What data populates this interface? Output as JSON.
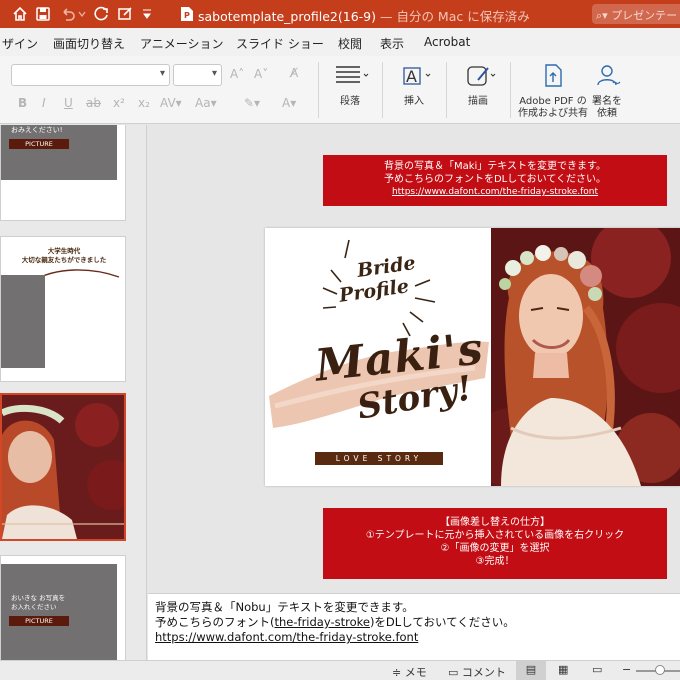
{
  "titlebar": {
    "doc_name": "sabotemplate_profile2(16-9)",
    "save_status": "— 自分の Mac に保存済み",
    "search_placeholder": "プレゼンテー",
    "color": "#c43e1c"
  },
  "ribbon_tabs": [
    "ザイン",
    "画面切り替え",
    "アニメーション",
    "スライド ショー",
    "校閲",
    "表示",
    "Acrobat"
  ],
  "ribbon": {
    "paragraph_label": "段落",
    "insert_label": "挿入",
    "draw_label": "描画",
    "adobe_pdf_label": "Adobe PDF の\n作成および共有",
    "sign_label": "署名を\n依頼"
  },
  "thumbnails": {
    "thumb1_text": "おみえください!",
    "thumb1_badge": "PICTURE",
    "thumb2_title": "大学生時代\n大切な親友たちができました",
    "thumb4_text": "おいきな お写真を\nお入れください",
    "thumb4_badge": "PICTURE"
  },
  "top_note": {
    "line1": "背景の写真＆「Maki」テキストを変更できます。",
    "line2": "予めこちらのフォントをDLしておいてください。",
    "link": "https://www.dafont.com/the-friday-stroke.font"
  },
  "slide": {
    "bride": "Bride",
    "profile": "Profile",
    "name_line1": "Maki's",
    "name_line2": "Story!",
    "love_story": "LOVE STORY"
  },
  "bottom_note": {
    "line1": "【画像差し替えの仕方】",
    "line2": "①テンプレートに元から挿入されている画像を右クリック",
    "line3": "②「画像の変更」を選択",
    "line4": "③完成！"
  },
  "notes": {
    "line1": "背景の写真＆「Nobu」テキストを変更できます。",
    "line2_a": "予めこちらのフォント(",
    "line2_link": "the-friday-stroke",
    "line2_b": ")をDLしておいてください。",
    "line3": "https://www.dafont.com/the-friday-stroke.font"
  },
  "status": {
    "notes_label": "メモ",
    "comments_label": "コメント"
  },
  "colors": {
    "accent_red": "#c30d14",
    "brown": "#5a2a10",
    "blush": "#ecc6b0",
    "selected_border": "#d24726"
  }
}
